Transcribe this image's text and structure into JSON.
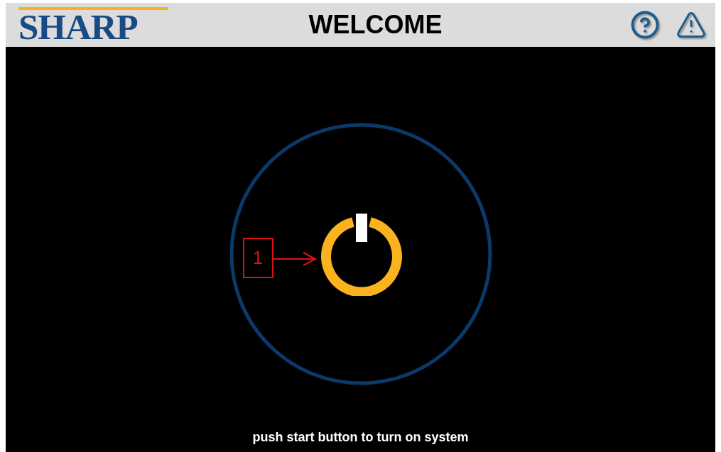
{
  "header": {
    "logo": "SHARP",
    "title": "WELCOME"
  },
  "power_button": {
    "callout": "1"
  },
  "footer": {
    "message": "push start button to turn on system"
  }
}
